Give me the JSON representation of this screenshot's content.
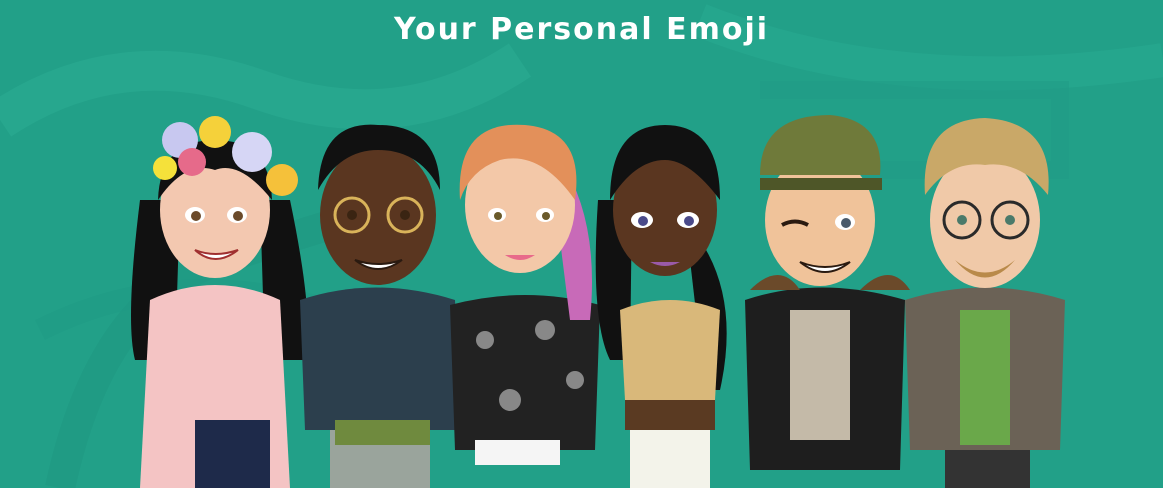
{
  "header": {
    "title": "Your Personal Emoji"
  },
  "theme": {
    "background": "#22a088",
    "title_color": "#ffffff"
  },
  "avatars": [
    {
      "name": "avatar-flower-crown-girl"
    },
    {
      "name": "avatar-braids-glasses-man"
    },
    {
      "name": "avatar-ginger-girl"
    },
    {
      "name": "avatar-braid-girl"
    },
    {
      "name": "avatar-cap-winking-man"
    },
    {
      "name": "avatar-blond-glasses-man"
    }
  ]
}
